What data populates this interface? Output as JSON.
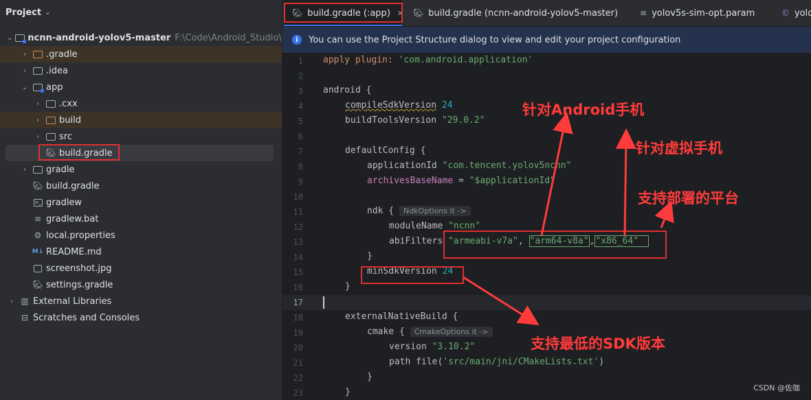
{
  "project": {
    "header": "Project",
    "tree": [
      {
        "label": "ncnn-android-yolov5-master",
        "path": "F:\\Code\\Android_Studio\\yolo",
        "bold": true,
        "indent": 0,
        "arrow": "⌄",
        "icon": "module-folder-icon"
      },
      {
        "label": ".gradle",
        "indent": 1,
        "arrow": "›",
        "icon": "folder-orange-icon",
        "hl": true
      },
      {
        "label": ".idea",
        "indent": 1,
        "arrow": "›",
        "icon": "folder-icon"
      },
      {
        "label": "app",
        "indent": 1,
        "arrow": "⌄",
        "icon": "module-folder-icon"
      },
      {
        "label": ".cxx",
        "indent": 2,
        "arrow": "›",
        "icon": "folder-icon"
      },
      {
        "label": "build",
        "indent": 2,
        "arrow": "›",
        "icon": "folder-orange-icon",
        "hl": true
      },
      {
        "label": "src",
        "indent": 2,
        "arrow": "›",
        "icon": "folder-icon"
      },
      {
        "label": "build.gradle",
        "indent": 2,
        "arrow": "",
        "icon": "gradle-icon",
        "selected": true
      },
      {
        "label": "gradle",
        "indent": 1,
        "arrow": "›",
        "icon": "folder-icon"
      },
      {
        "label": "build.gradle",
        "indent": 1,
        "arrow": "",
        "icon": "gradle-icon"
      },
      {
        "label": "gradlew",
        "indent": 1,
        "arrow": "",
        "icon": "terminal-icon"
      },
      {
        "label": "gradlew.bat",
        "indent": 1,
        "arrow": "",
        "icon": "text-file-icon"
      },
      {
        "label": "local.properties",
        "indent": 1,
        "arrow": "",
        "icon": "settings-icon"
      },
      {
        "label": "README.md",
        "indent": 1,
        "arrow": "",
        "icon": "markdown-icon"
      },
      {
        "label": "screenshot.jpg",
        "indent": 1,
        "arrow": "",
        "icon": "image-icon"
      },
      {
        "label": "settings.gradle",
        "indent": 1,
        "arrow": "",
        "icon": "gradle-icon"
      },
      {
        "label": "External Libraries",
        "indent": 0,
        "arrow": "›",
        "icon": "library-icon"
      },
      {
        "label": "Scratches and Consoles",
        "indent": 0,
        "arrow": "",
        "icon": "scratches-icon"
      }
    ]
  },
  "tabs": [
    {
      "label": "build.gradle (:app)",
      "active": true,
      "icon": "gradle-icon"
    },
    {
      "label": "build.gradle (ncnn-android-yolov5-master)",
      "active": false,
      "icon": "gradle-icon"
    },
    {
      "label": "yolov5s-sim-opt.param",
      "active": false,
      "icon": "text-file-icon"
    },
    {
      "label": "yolo",
      "active": false,
      "icon": "cpp-file-icon"
    }
  ],
  "banner": "You can use the Project Structure dialog to view and edit your project configuration",
  "code": {
    "l1_a": "apply ",
    "l1_b": "plugin: ",
    "l1_c": "'com.android.application'",
    "l3": "android {",
    "l4_a": "compileSdkVersion",
    "l4_b": "24",
    "l5_a": "buildToolsVersion ",
    "l5_b": "\"29.0.2\"",
    "l7": "defaultConfig {",
    "l8_a": "applicationId ",
    "l8_b": "\"com.tencent.yolov5ncnn\"",
    "l9_a": "archivesBaseName",
    "l9_b": " = ",
    "l9_c": "\"$applicationId\"",
    "l11_a": "ndk {",
    "l11_hint": "NdkOptions it ->",
    "l12_a": "moduleName ",
    "l12_b": "\"ncnn\"",
    "l13_a": "abiFilters ",
    "l13_b": "\"armeabi-v7a\"",
    "l13_c": ", ",
    "l13_d": "\"arm64-v8a\"",
    "l13_e": ",",
    "l13_f": "\"x86_64\"",
    "l14": "}",
    "l15_a": "minSdkVersion ",
    "l15_b": "24",
    "l16": "}",
    "l18": "externalNativeBuild {",
    "l19_a": "cmake {",
    "l19_hint": "CmakeOptions it ->",
    "l20_a": "version ",
    "l20_b": "\"3.10.2\"",
    "l21_a": "path file(",
    "l21_b": "'src/main/jni/CMakeLists.txt'",
    "l21_c": ")",
    "l22": "}",
    "l23": "}"
  },
  "annotations": {
    "android_phone": "针对Android手机",
    "virtual_phone": "针对虚拟手机",
    "platforms": "支持部署的平台",
    "min_sdk": "支持最低的SDK版本"
  },
  "watermark": "CSDN @佐咖",
  "colors": {
    "annotation": "#ff3b3b",
    "accent": "#3574f0"
  }
}
